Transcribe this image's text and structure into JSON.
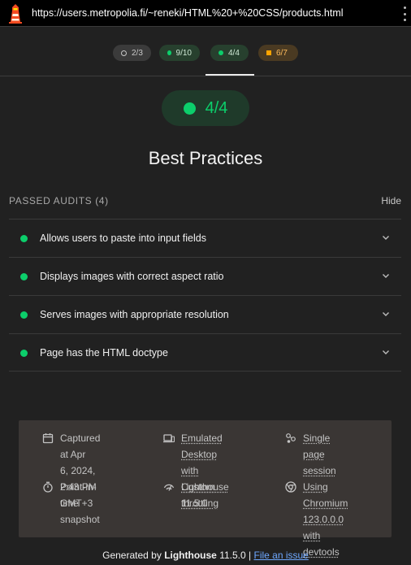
{
  "browser": {
    "url": "https://users.metropolia.fi/~reneki/HTML%20+%20CSS/products.html"
  },
  "score_pills": [
    {
      "label": "2/3",
      "kind": "neutral"
    },
    {
      "label": "9/10",
      "kind": "pass"
    },
    {
      "label": "4/4",
      "kind": "pass"
    },
    {
      "label": "6/7",
      "kind": "average"
    }
  ],
  "category": {
    "score": "4/4",
    "title": "Best Practices"
  },
  "audits": {
    "header": "PASSED AUDITS (4)",
    "toggle": "Hide",
    "items": [
      "Allows users to paste into input fields",
      "Displays images with correct aspect ratio",
      "Serves images with appropriate resolution",
      "Page has the HTML doctype"
    ]
  },
  "environment": {
    "captured": [
      "Captured at Apr",
      "6, 2024, 2:43 PM",
      "GMT+3"
    ],
    "emulated": [
      "Emulated",
      "Desktop with",
      "Lighthouse 11.5.0"
    ],
    "session": [
      "Single page",
      "session"
    ],
    "snapshot": [
      "Point-in-time",
      "snapshot"
    ],
    "throttling": [
      "Custom throttling"
    ],
    "chromium": [
      "Using Chromium",
      "123.0.0.0 with",
      "devtools"
    ]
  },
  "footer": {
    "prefix": "Generated by",
    "product": "Lighthouse",
    "version": "11.5.0 |",
    "link": "File an issue"
  },
  "colors": {
    "pass": "#0cce6b",
    "average": "#ffa400",
    "background": "#212121"
  },
  "icons": [
    "lighthouse-logo-icon",
    "kebab-menu-icon",
    "chevron-down-icon",
    "calendar-icon",
    "devices-icon",
    "session-icon",
    "timer-icon",
    "throttling-icon",
    "chrome-icon"
  ]
}
